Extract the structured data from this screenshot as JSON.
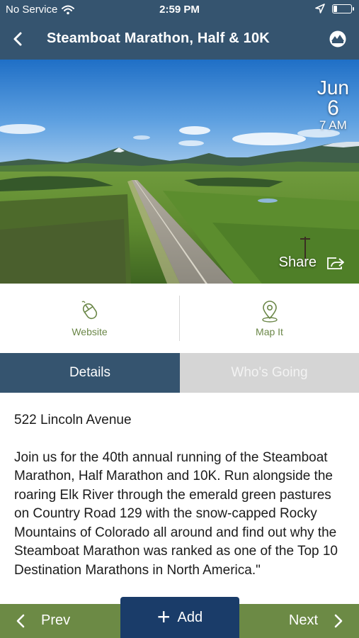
{
  "status_bar": {
    "carrier": "No Service",
    "time": "2:59 PM",
    "icons": [
      "wifi-icon",
      "location-arrow-icon",
      "battery-icon"
    ],
    "battery_level": 0.2
  },
  "nav": {
    "title": "Steamboat Marathon, Half & 10K",
    "back_icon": "chevron-left-icon",
    "logo_icon": "app-logo-icon"
  },
  "hero": {
    "month": "Jun",
    "day": "6",
    "hour": "7 AM",
    "share_label": "Share",
    "share_icon": "share-icon"
  },
  "actions": {
    "website_label": "Website",
    "website_icon": "mouse-icon",
    "map_label": "Map It",
    "map_icon": "map-pin-icon"
  },
  "tabs": {
    "details": "Details",
    "whos_going": "Who's Going",
    "active": "details"
  },
  "content": {
    "address": "522 Lincoln Avenue",
    "description": "Join us for the 40th annual running of the Steamboat Marathon, Half Marathon and 10K. Run alongside the roaring Elk River through the emerald green pastures on Country Road 129 with the snow-capped Rocky Mountains of Colorado all around and find out why the Steamboat Marathon was ranked as one of the Top 10 Destination Marathons in North America.\""
  },
  "bottom_bar": {
    "prev_label": "Prev",
    "add_label": "Add",
    "next_label": "Next"
  },
  "colors": {
    "header": "#35546f",
    "accent_green": "#6c8a45",
    "add_button": "#1a3c69",
    "inactive_tab": "#d5d5d5"
  }
}
